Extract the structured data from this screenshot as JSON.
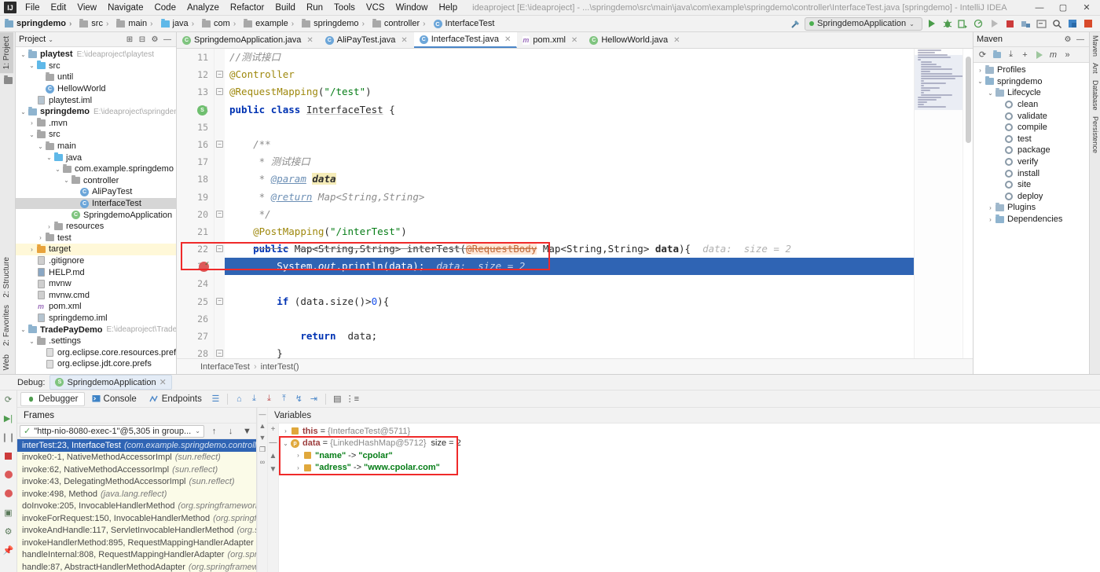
{
  "window": {
    "title": "ideaproject [E:\\ideaproject] - ...\\springdemo\\src\\main\\java\\com\\example\\springdemo\\controller\\InterfaceTest.java [springdemo] - IntelliJ IDEA",
    "minimize": "—",
    "maximize": "▢",
    "close": "✕",
    "logo": "IJ"
  },
  "menu": [
    "File",
    "Edit",
    "View",
    "Navigate",
    "Code",
    "Analyze",
    "Refactor",
    "Build",
    "Run",
    "Tools",
    "VCS",
    "Window",
    "Help"
  ],
  "breadcrumbs": [
    {
      "label": "springdemo",
      "icon": "module-icon"
    },
    {
      "label": "src",
      "icon": "folder-icon"
    },
    {
      "label": "main",
      "icon": "folder-icon"
    },
    {
      "label": "java",
      "icon": "source-folder-icon"
    },
    {
      "label": "com",
      "icon": "package-icon"
    },
    {
      "label": "example",
      "icon": "package-icon"
    },
    {
      "label": "springdemo",
      "icon": "package-icon"
    },
    {
      "label": "controller",
      "icon": "package-icon"
    },
    {
      "label": "InterfaceTest",
      "icon": "class-icon"
    }
  ],
  "toolbar": {
    "run_configuration": "SpringdemoApplication",
    "dropdown_caret": "⌄",
    "build_label": "Build",
    "run_label": "Run",
    "debug_label": "Debug",
    "run_coverage_label": "Run with Coverage",
    "profile_label": "Profile",
    "stop_label": "Stop",
    "search_label": "Search Everywhere"
  },
  "project_panel": {
    "title": "Project",
    "caret": "⌄",
    "actions": [
      "collapse-all",
      "settings",
      "hide"
    ],
    "tree": [
      {
        "indent": 0,
        "arrow": "⌄",
        "icon": "module-icon",
        "label": "playtest",
        "bold": true,
        "path": "E:\\ideaproject\\playtest"
      },
      {
        "indent": 1,
        "arrow": "⌄",
        "icon": "source-folder-icon",
        "label": "src"
      },
      {
        "indent": 2,
        "arrow": "",
        "icon": "package-icon",
        "label": "until"
      },
      {
        "indent": 2,
        "arrow": "",
        "icon": "class-icon",
        "label": "HellowWorld"
      },
      {
        "indent": 1,
        "arrow": "",
        "icon": "iml-icon",
        "label": "playtest.iml"
      },
      {
        "indent": 0,
        "arrow": "⌄",
        "icon": "module-icon",
        "label": "springdemo",
        "bold": true,
        "path": "E:\\ideaproject\\springdemo"
      },
      {
        "indent": 1,
        "arrow": "›",
        "icon": "folder-icon",
        "label": ".mvn"
      },
      {
        "indent": 1,
        "arrow": "⌄",
        "icon": "folder-icon",
        "label": "src"
      },
      {
        "indent": 2,
        "arrow": "⌄",
        "icon": "folder-icon",
        "label": "main"
      },
      {
        "indent": 3,
        "arrow": "⌄",
        "icon": "source-folder-icon",
        "label": "java"
      },
      {
        "indent": 4,
        "arrow": "⌄",
        "icon": "package-icon",
        "label": "com.example.springdemo"
      },
      {
        "indent": 5,
        "arrow": "⌄",
        "icon": "package-icon",
        "label": "controller"
      },
      {
        "indent": 6,
        "arrow": "",
        "icon": "class-icon",
        "label": "AliPayTest"
      },
      {
        "indent": 6,
        "arrow": "",
        "icon": "class-icon",
        "label": "InterfaceTest",
        "selected": true
      },
      {
        "indent": 5,
        "arrow": "",
        "icon": "spring-class-icon",
        "label": "SpringdemoApplication"
      },
      {
        "indent": 3,
        "arrow": "›",
        "icon": "folder-icon",
        "label": "resources"
      },
      {
        "indent": 2,
        "arrow": "›",
        "icon": "folder-icon",
        "label": "test"
      },
      {
        "indent": 1,
        "arrow": "›",
        "icon": "target-folder-icon",
        "label": "target",
        "highlight": true
      },
      {
        "indent": 1,
        "arrow": "",
        "icon": "git-icon",
        "label": ".gitignore"
      },
      {
        "indent": 1,
        "arrow": "",
        "icon": "md-icon",
        "label": "HELP.md"
      },
      {
        "indent": 1,
        "arrow": "",
        "icon": "file-icon",
        "label": "mvnw"
      },
      {
        "indent": 1,
        "arrow": "",
        "icon": "file-icon",
        "label": "mvnw.cmd"
      },
      {
        "indent": 1,
        "arrow": "",
        "icon": "maven-icon",
        "label": "pom.xml"
      },
      {
        "indent": 1,
        "arrow": "",
        "icon": "iml-icon",
        "label": "springdemo.iml"
      },
      {
        "indent": 0,
        "arrow": "⌄",
        "icon": "module-icon",
        "label": "TradePayDemo",
        "bold": true,
        "path": "E:\\ideaproject\\TradePay"
      },
      {
        "indent": 1,
        "arrow": "⌄",
        "icon": "folder-icon",
        "label": ".settings"
      },
      {
        "indent": 2,
        "arrow": "",
        "icon": "prefs-icon",
        "label": "org.eclipse.core.resources.prefs"
      },
      {
        "indent": 2,
        "arrow": "",
        "icon": "prefs-icon",
        "label": "org.eclipse.jdt.core.prefs"
      }
    ]
  },
  "left_rail": {
    "top": [
      {
        "label": "1: Project",
        "active": true
      }
    ],
    "bottom": [
      {
        "label": "2: Structure"
      },
      {
        "label": "2: Favorites"
      },
      {
        "label": "Web"
      }
    ]
  },
  "editor": {
    "tabs": [
      {
        "label": "SpringdemoApplication.java",
        "icon": "spring-class-icon",
        "active": false
      },
      {
        "label": "AliPayTest.java",
        "icon": "class-icon",
        "active": false
      },
      {
        "label": "InterfaceTest.java",
        "icon": "class-icon",
        "active": true
      },
      {
        "label": "pom.xml",
        "icon": "maven-icon",
        "active": false
      },
      {
        "label": "HellowWorld.java",
        "icon": "spring-class-icon",
        "active": false
      }
    ],
    "first_line": 11,
    "lines": [
      {
        "n": 11,
        "text": "//测试接口"
      },
      {
        "n": 12,
        "text": "@Controller"
      },
      {
        "n": 13,
        "text": "@RequestMapping(\"/test\")"
      },
      {
        "n": 14,
        "text": "public class InterfaceTest {"
      },
      {
        "n": 15,
        "text": ""
      },
      {
        "n": 16,
        "text": "    /**"
      },
      {
        "n": 17,
        "text": "     * 测试接口"
      },
      {
        "n": 18,
        "text": "     * @param data"
      },
      {
        "n": 19,
        "text": "     * @return Map<String,String>"
      },
      {
        "n": 20,
        "text": "     */"
      },
      {
        "n": 21,
        "text": "    @PostMapping(\"/interTest\")"
      },
      {
        "n": 22,
        "text": "    public Map<String,String> interTest(@RequestBody Map<String,String> data){"
      },
      {
        "n": 23,
        "text": "        System.out.println(data);"
      },
      {
        "n": 24,
        "text": ""
      },
      {
        "n": 25,
        "text": "        if (data.size()>0){"
      },
      {
        "n": 26,
        "text": ""
      },
      {
        "n": 27,
        "text": "            return  data;"
      },
      {
        "n": 28,
        "text": "        }"
      },
      {
        "n": 29,
        "text": ""
      }
    ],
    "inline_hints": {
      "line22": "data:  size = 2",
      "line23": "data:  size = 2"
    },
    "breadcrumb": {
      "class": "InterfaceTest",
      "method": "interTest()",
      "sep": "›"
    },
    "gutter": {
      "breakpoint_line": 23,
      "spring_bean_line": 14
    }
  },
  "maven_panel": {
    "title": "Maven",
    "minimize": "—",
    "settings": "⚙",
    "toolbar_icons": [
      "reload",
      "add-maven-project",
      "download-sources",
      "add",
      "run",
      "m-options",
      "more"
    ],
    "tree": [
      {
        "indent": 0,
        "arrow": "›",
        "icon": "profiles-icon",
        "label": "Profiles"
      },
      {
        "indent": 0,
        "arrow": "⌄",
        "icon": "maven-module-icon",
        "label": "springdemo"
      },
      {
        "indent": 1,
        "arrow": "⌄",
        "icon": "lifecycle-icon",
        "label": "Lifecycle"
      },
      {
        "indent": 2,
        "arrow": "",
        "icon": "goal-icon",
        "label": "clean"
      },
      {
        "indent": 2,
        "arrow": "",
        "icon": "goal-icon",
        "label": "validate"
      },
      {
        "indent": 2,
        "arrow": "",
        "icon": "goal-icon",
        "label": "compile"
      },
      {
        "indent": 2,
        "arrow": "",
        "icon": "goal-icon",
        "label": "test"
      },
      {
        "indent": 2,
        "arrow": "",
        "icon": "goal-icon",
        "label": "package"
      },
      {
        "indent": 2,
        "arrow": "",
        "icon": "goal-icon",
        "label": "verify"
      },
      {
        "indent": 2,
        "arrow": "",
        "icon": "goal-icon",
        "label": "install"
      },
      {
        "indent": 2,
        "arrow": "",
        "icon": "goal-icon",
        "label": "site"
      },
      {
        "indent": 2,
        "arrow": "",
        "icon": "goal-icon",
        "label": "deploy"
      },
      {
        "indent": 1,
        "arrow": "›",
        "icon": "plugins-icon",
        "label": "Plugins"
      },
      {
        "indent": 1,
        "arrow": "›",
        "icon": "dependencies-icon",
        "label": "Dependencies"
      }
    ]
  },
  "right_rail": [
    {
      "label": "Maven"
    },
    {
      "label": "Ant"
    },
    {
      "label": "Database"
    },
    {
      "label": "Persistence"
    }
  ],
  "debug": {
    "header_label": "Debug:",
    "session_name": "SpringdemoApplication",
    "close": "✕",
    "tabs": [
      {
        "label": "Debugger",
        "icon": "debugger-icon",
        "active": true
      },
      {
        "label": "Console",
        "icon": "console-icon",
        "active": false
      },
      {
        "label": "Endpoints",
        "icon": "endpoints-icon",
        "active": false
      }
    ],
    "toolbar_icons": [
      "layout-icon",
      "show-execution-point-icon",
      "step-over-icon",
      "step-into-icon",
      "force-step-into-icon",
      "step-out-icon",
      "drop-frame-icon",
      "run-to-cursor-icon",
      "evaluate-icon",
      "settings-icon"
    ],
    "rail_icons": [
      "rerun-icon",
      "resume-icon",
      "pause-icon",
      "stop-icon",
      "mute-breakpoints-icon",
      "view-breakpoints-icon",
      "camera-icon",
      "settings-icon",
      "pin-icon"
    ],
    "frames": {
      "title": "Frames",
      "thread": "\"http-nio-8080-exec-1\"@5,305 in group...",
      "thread_caret": "⌄",
      "actions": [
        "up-arrow",
        "down-arrow",
        "filter-icon"
      ],
      "items": [
        {
          "method": "interTest:23, InterfaceTest",
          "pkg": "(com.example.springdemo.controller)",
          "selected": true
        },
        {
          "method": "invoke0:-1, NativeMethodAccessorImpl",
          "pkg": "(sun.reflect)"
        },
        {
          "method": "invoke:62, NativeMethodAccessorImpl",
          "pkg": "(sun.reflect)"
        },
        {
          "method": "invoke:43, DelegatingMethodAccessorImpl",
          "pkg": "(sun.reflect)"
        },
        {
          "method": "invoke:498, Method",
          "pkg": "(java.lang.reflect)"
        },
        {
          "method": "doInvoke:205, InvocableHandlerMethod",
          "pkg": "(org.springframework.web.method.support)"
        },
        {
          "method": "invokeForRequest:150, InvocableHandlerMethod",
          "pkg": "(org.springframework.web"
        },
        {
          "method": "invokeAndHandle:117, ServletInvocableHandlerMethod",
          "pkg": "(org.springframework"
        },
        {
          "method": "invokeHandlerMethod:895, RequestMappingHandlerAdapter",
          "pkg": "(org.springframewor"
        },
        {
          "method": "handleInternal:808, RequestMappingHandlerAdapter",
          "pkg": "(org.springframework.we"
        },
        {
          "method": "handle:87, AbstractHandlerMethodAdapter",
          "pkg": "(org.springframework.web.servlet"
        }
      ]
    },
    "variables": {
      "title": "Variables",
      "add_button": "+",
      "remove_button": "—",
      "items": [
        {
          "indent": 0,
          "arrow": "›",
          "icon": "object-icon",
          "name": "this",
          "eq": "=",
          "value": "{InterfaceTest@5711}"
        },
        {
          "indent": 0,
          "arrow": "⌄",
          "icon": "param-icon",
          "name": "data",
          "eq": "=",
          "value": "{LinkedHashMap@5712}",
          "size": "size = 2"
        },
        {
          "indent": 1,
          "arrow": "›",
          "icon": "entry-icon",
          "name": "\"name\"",
          "eq": "->",
          "value": "\"cpolar\"",
          "green": true
        },
        {
          "indent": 1,
          "arrow": "›",
          "icon": "entry-icon",
          "name": "\"adress\"",
          "eq": "->",
          "value": "\"www.cpolar.com\"",
          "green": true
        }
      ]
    }
  },
  "colors": {
    "accent": "#2f64b4",
    "highlight_box": "#ef2a2a",
    "keyword": "#0033b3",
    "string": "#067d17",
    "annotation": "#9e880d",
    "comment": "#8c8c8c",
    "frames_bg": "#fbfbe8"
  }
}
